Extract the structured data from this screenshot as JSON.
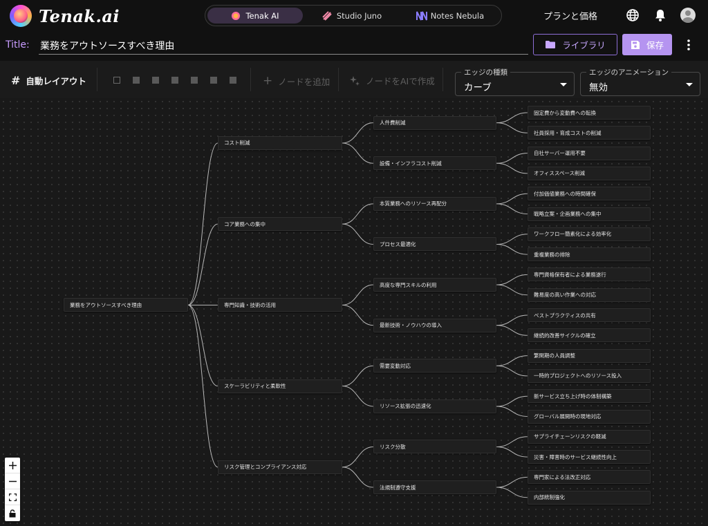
{
  "app": {
    "name": "Tenak.ai"
  },
  "switcher": {
    "items": [
      {
        "label": "Tenak AI",
        "active": true
      },
      {
        "label": "Studio Juno",
        "active": false
      },
      {
        "label": "Notes Nebula",
        "active": false
      }
    ]
  },
  "header": {
    "plan_link": "プランと価格",
    "icons": [
      "globe-icon",
      "bell-icon",
      "avatar"
    ]
  },
  "title_row": {
    "label": "Title:",
    "value": "業務をアウトソースすべき理由",
    "library_button": "ライブラリ",
    "save_button": "保存"
  },
  "toolbar": {
    "auto_layout": "自動レイアウト",
    "add_node": "ノードを追加",
    "ai_node": "ノードをAIで作成",
    "edge_type": {
      "legend": "エッジの種類",
      "value": "カーブ"
    },
    "edge_animation": {
      "legend": "エッジのアニメーション",
      "value": "無効"
    }
  },
  "colors": {
    "accent": "#b594f0",
    "accent_text": "#c89cff"
  },
  "mindmap": {
    "root": "業務をアウトソースすべき理由",
    "branches": [
      {
        "label": "コスト削減",
        "children": [
          {
            "label": "人件費削減",
            "children": [
              "固定費から変動費への転換",
              "社員採用・育成コストの削減"
            ]
          },
          {
            "label": "設備・インフラコスト削減",
            "children": [
              "自社サーバー運用不要",
              "オフィススペース削減"
            ]
          }
        ]
      },
      {
        "label": "コア業務への集中",
        "children": [
          {
            "label": "本質業務へのリソース再配分",
            "children": [
              "付加価値業務への時間確保",
              "戦略立案・企画業務への集中"
            ]
          },
          {
            "label": "プロセス最適化",
            "children": [
              "ワークフロー簡素化による効率化",
              "重複業務の排除"
            ]
          }
        ]
      },
      {
        "label": "専門知識・技術の活用",
        "children": [
          {
            "label": "高度な専門スキルの利用",
            "children": [
              "専門資格保有者による業務遂行",
              "難易度の高い作業への対応"
            ]
          },
          {
            "label": "最新技術・ノウハウの導入",
            "children": [
              "ベストプラクティスの共有",
              "継続的改善サイクルの確立"
            ]
          }
        ]
      },
      {
        "label": "スケーラビリティと柔軟性",
        "children": [
          {
            "label": "需要変動対応",
            "children": [
              "繁閑期の人員調整",
              "一時的プロジェクトへのリソース投入"
            ]
          },
          {
            "label": "リソース拡張の迅速化",
            "children": [
              "新サービス立ち上げ時の体制構築",
              "グローバル展開時の現地対応"
            ]
          }
        ]
      },
      {
        "label": "リスク管理とコンプライアンス対応",
        "children": [
          {
            "label": "リスク分散",
            "children": [
              "サプライチェーンリスクの軽減",
              "災害・障害時のサービス継続性向上"
            ]
          },
          {
            "label": "法規制遵守支援",
            "children": [
              "専門家による法改正対応",
              "内部統制強化"
            ]
          }
        ]
      }
    ]
  },
  "zoom_controls": [
    "plus-icon",
    "minus-icon",
    "fit-view-icon",
    "lock-icon"
  ]
}
